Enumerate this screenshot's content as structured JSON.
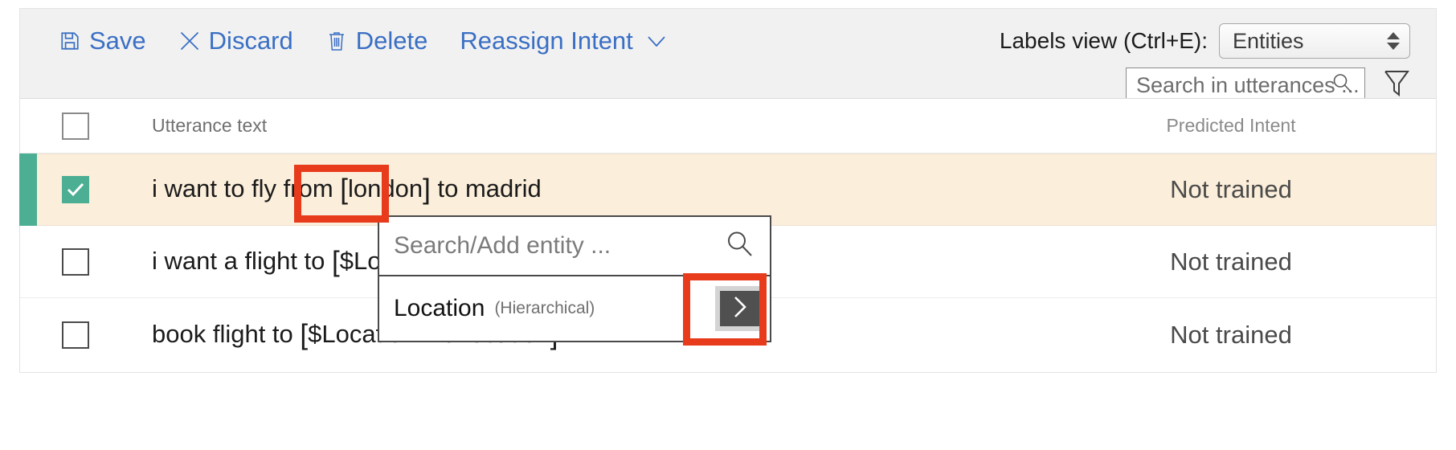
{
  "toolbar": {
    "buttons": [
      {
        "label": "Save",
        "icon": "save-icon"
      },
      {
        "label": "Discard",
        "icon": "close-icon"
      },
      {
        "label": "Delete",
        "icon": "trash-icon"
      },
      {
        "label": "Reassign Intent",
        "icon": "chevron-down-icon"
      }
    ],
    "labels_view_label": "Labels view (Ctrl+E):",
    "labels_view_value": "Entities",
    "labels_view_options": [
      "Entities"
    ],
    "search_placeholder": "Search in utterances ...",
    "search_value": "",
    "filter_icon": "filter-icon"
  },
  "table": {
    "columns": {
      "utterance": "Utterance text",
      "intent": "Predicted Intent"
    },
    "rows": [
      {
        "checked": true,
        "selected": true,
        "text_before": "i want to fly from ",
        "open_bracket": "[",
        "entity": "london",
        "close_bracket": "]",
        "text_after": " to madrid",
        "intent": "Not trained"
      },
      {
        "checked": false,
        "selected": false,
        "text_before": "i want a flight to ",
        "open_bracket": "[",
        "entity": "$Locatio",
        "close_bracket": "",
        "text_after": "",
        "intent": "Not trained"
      },
      {
        "checked": false,
        "selected": false,
        "text_before": "book flight to ",
        "open_bracket": "[",
        "entity": "$Location::ToLocation",
        "close_bracket": "]",
        "text_after": "",
        "intent": "Not trained"
      }
    ]
  },
  "popup": {
    "search_placeholder": "Search/Add entity ...",
    "search_value": "",
    "search_icon": "search-icon",
    "item_name": "Location",
    "item_kind": "(Hierarchical)",
    "expand_icon": "chevron-right-icon"
  },
  "colors": {
    "accent_blue": "#3a6fc4",
    "selection_green": "#4cae93",
    "selected_row_bg": "#fbeeda",
    "annotation_red": "#e83b1c",
    "toolbar_bg": "#f1f1f1"
  }
}
